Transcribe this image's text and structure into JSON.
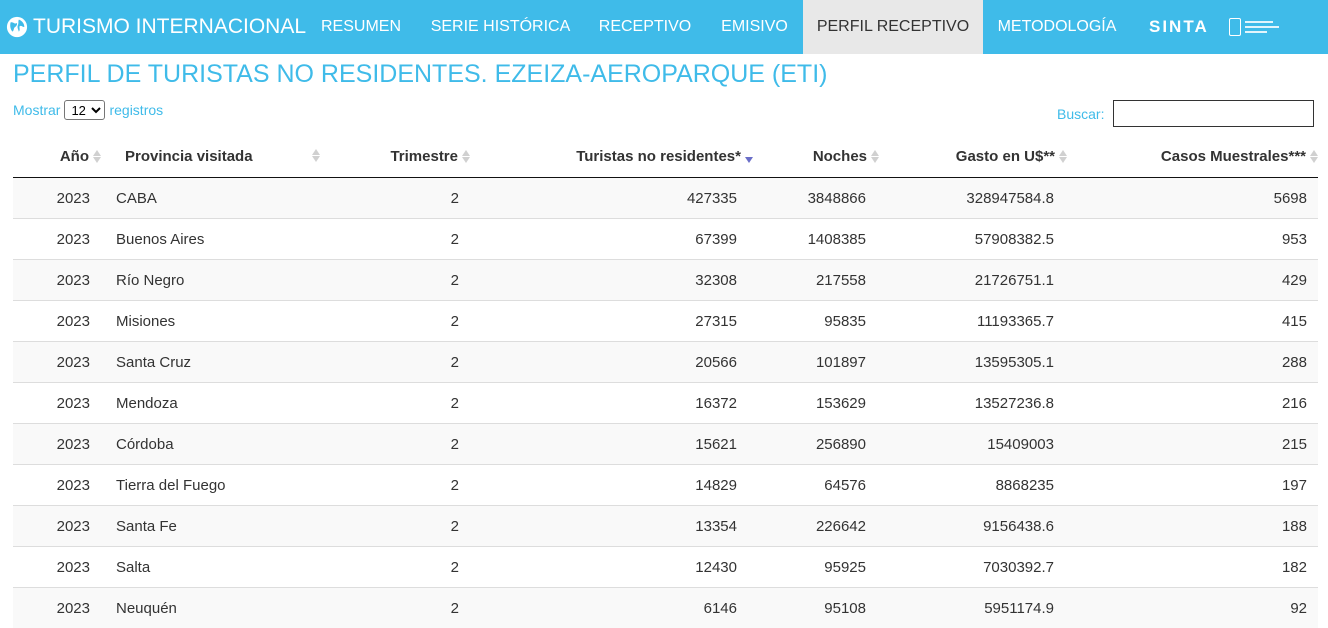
{
  "nav": {
    "brand": "TURISMO INTERNACIONAL",
    "items": [
      "RESUMEN",
      "SERIE HISTÓRICA",
      "RECEPTIVO",
      "EMISIVO",
      "PERFIL RECEPTIVO",
      "METODOLOGÍA"
    ],
    "active": "PERFIL RECEPTIVO",
    "sinta": "SINTA"
  },
  "page": {
    "title": "PERFIL DE TURISTAS NO RESIDENTES. EZEIZA-AEROPARQUE (ETI)"
  },
  "length": {
    "prefix": "Mostrar",
    "value": "12",
    "suffix": "registros"
  },
  "search": {
    "label": "Buscar:",
    "value": ""
  },
  "table": {
    "columns": [
      "Año",
      "Provincia visitada",
      "Trimestre",
      "Turistas no residentes*",
      "Noches",
      "Gasto en U$**",
      "Casos Muestrales***"
    ],
    "sorted_column": "Turistas no residentes*",
    "sort_direction": "desc",
    "rows": [
      [
        "2023",
        "CABA",
        "2",
        "427335",
        "3848866",
        "328947584.8",
        "5698"
      ],
      [
        "2023",
        "Buenos Aires",
        "2",
        "67399",
        "1408385",
        "57908382.5",
        "953"
      ],
      [
        "2023",
        "Río Negro",
        "2",
        "32308",
        "217558",
        "21726751.1",
        "429"
      ],
      [
        "2023",
        "Misiones",
        "2",
        "27315",
        "95835",
        "11193365.7",
        "415"
      ],
      [
        "2023",
        "Santa Cruz",
        "2",
        "20566",
        "101897",
        "13595305.1",
        "288"
      ],
      [
        "2023",
        "Mendoza",
        "2",
        "16372",
        "153629",
        "13527236.8",
        "216"
      ],
      [
        "2023",
        "Córdoba",
        "2",
        "15621",
        "256890",
        "15409003",
        "215"
      ],
      [
        "2023",
        "Tierra del Fuego",
        "2",
        "14829",
        "64576",
        "8868235",
        "197"
      ],
      [
        "2023",
        "Santa Fe",
        "2",
        "13354",
        "226642",
        "9156438.6",
        "188"
      ],
      [
        "2023",
        "Salta",
        "2",
        "12430",
        "95925",
        "7030392.7",
        "182"
      ],
      [
        "2023",
        "Neuquén",
        "2",
        "6146",
        "95108",
        "5951174.9",
        "92"
      ]
    ]
  },
  "colors": {
    "accent": "#3fbbe9",
    "active_tab": "#e8e8e8",
    "sort_active": "#6a6ec8"
  }
}
